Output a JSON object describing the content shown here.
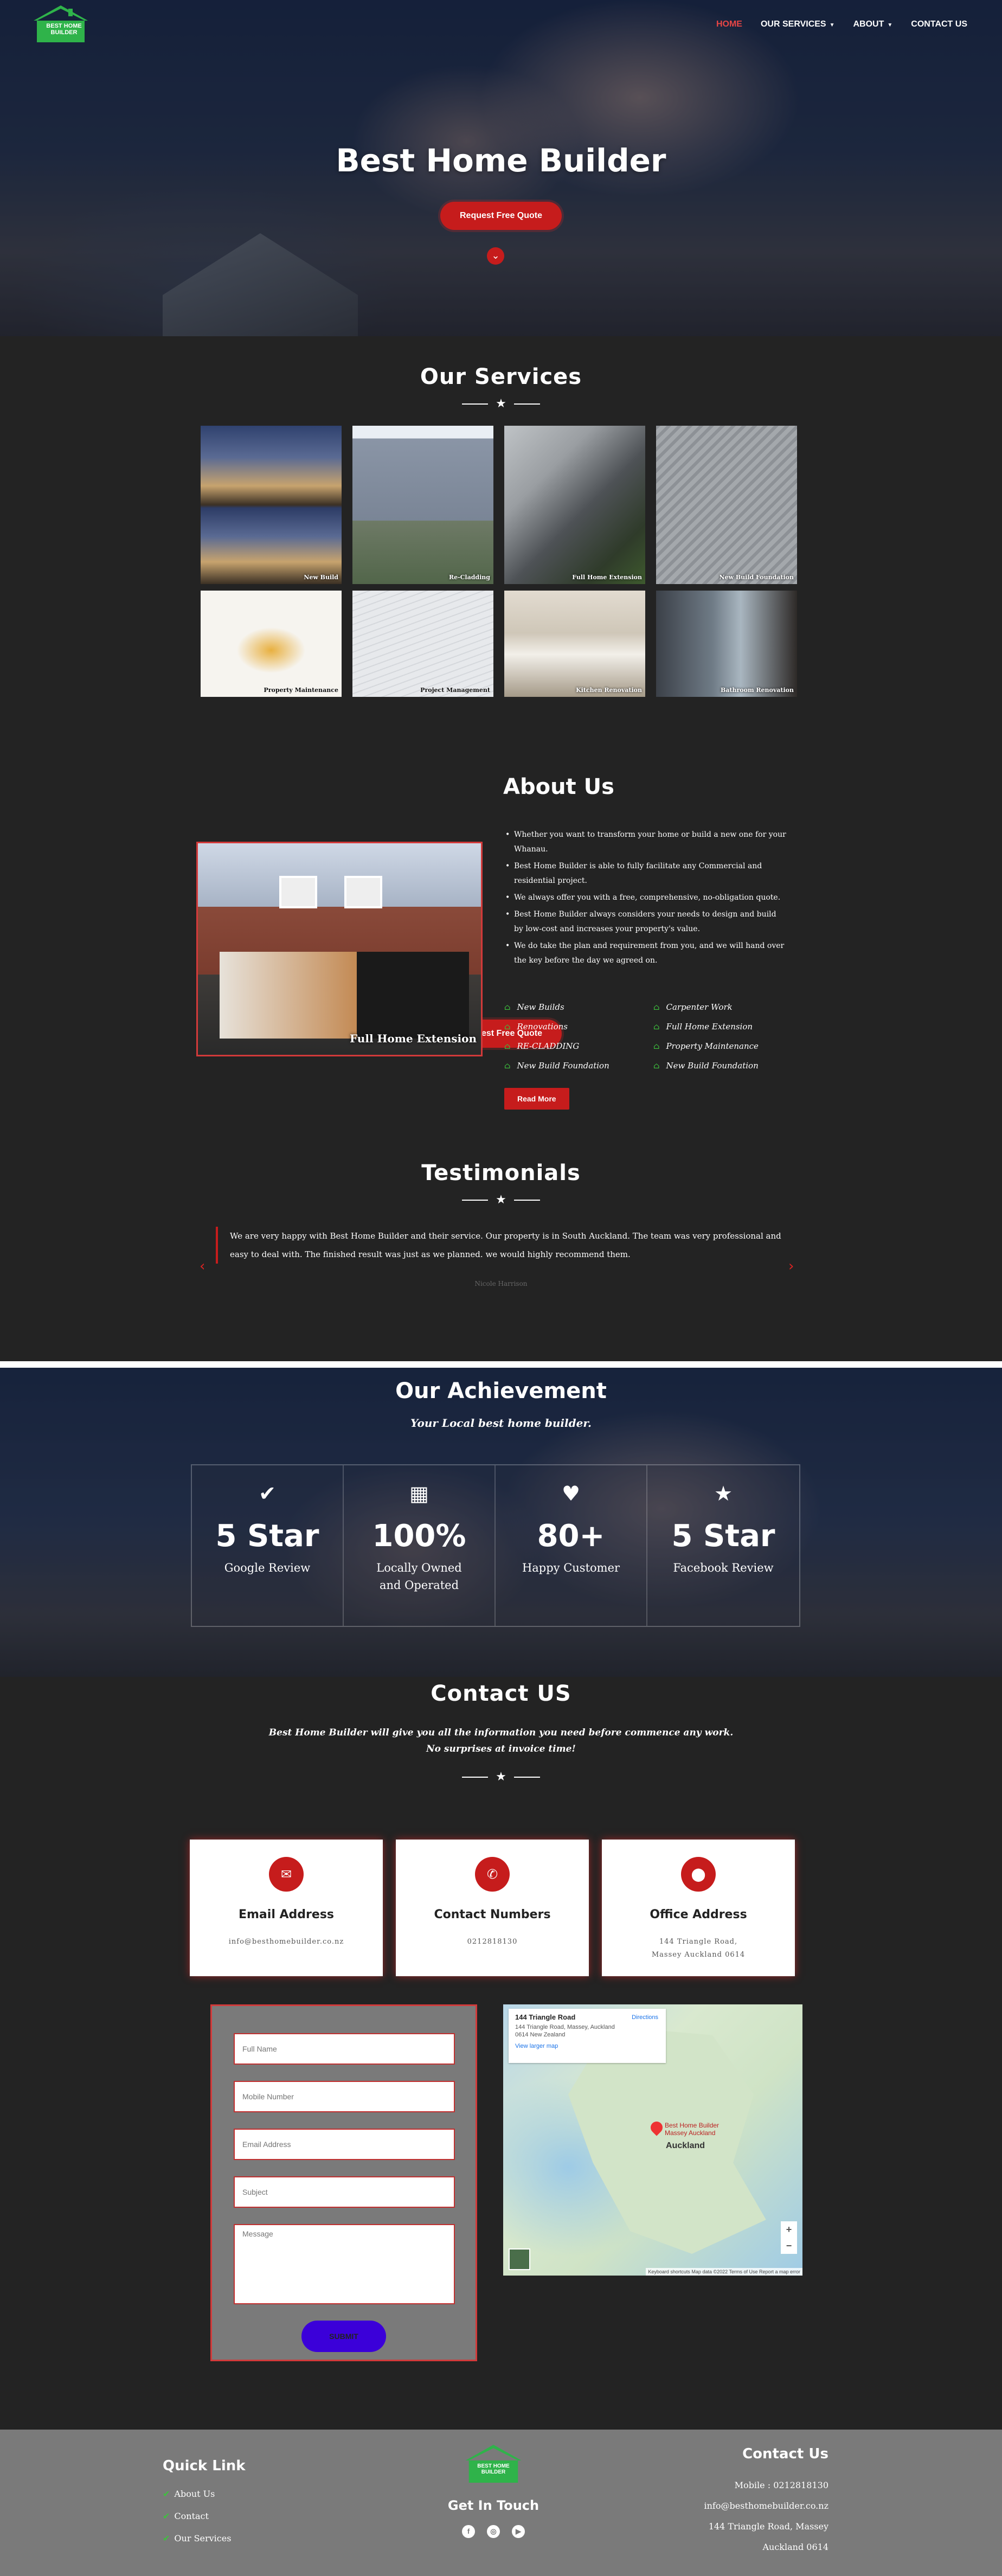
{
  "nav": {
    "logo_text": "BEST HOME BUILDER",
    "items": [
      {
        "label": "HOME",
        "active": true
      },
      {
        "label": "OUR SERVICES",
        "dropdown": true
      },
      {
        "label": "ABOUT",
        "dropdown": true
      },
      {
        "label": "CONTACT US"
      }
    ]
  },
  "hero": {
    "title": "Best Home Builder",
    "cta": "Request Free Quote",
    "scroll_icon": "chevron-down-circle-icon"
  },
  "services": {
    "title": "Our Services",
    "items": [
      {
        "caption": "New Build"
      },
      {
        "caption": "Re-Cladding"
      },
      {
        "caption": "Full Home Extension"
      },
      {
        "caption": "New Build Foundation"
      },
      {
        "caption": "Property Maintenance"
      },
      {
        "caption": "Project Management"
      },
      {
        "caption": "Kitchen Renovation"
      },
      {
        "caption": "Bathroom Renovation"
      }
    ],
    "cta": "Request Free Quote"
  },
  "about": {
    "title": "About Us",
    "image_caption": "Full Home Extension",
    "bullets": [
      "Whether you want to transform your home or build a new one for your Whanau.",
      "Best Home Builder is able to fully facilitate any Commercial and residential project.",
      "We always offer you with a free, comprehensive, no-obligation quote.",
      "Best Home Builder always considers your needs to design and build by low-cost and increases your property's value.",
      "We do take the plan and requirement from you, and we will hand over the key before the day we agreed on."
    ],
    "checks": [
      "New Builds",
      "Carpenter Work",
      "Renovations",
      "Full Home Extension",
      "RE-CLADDING",
      "Property Maintenance",
      "New Build Foundation",
      "New Build Foundation"
    ],
    "cta": "Read More"
  },
  "testimonials": {
    "title": "Testimonials",
    "quote": "We are very happy with Best Home Builder and their service. Our property is in South Auckland. The team was very professional and easy to deal with. The finished result was just as we planned. we would highly recommend them.",
    "author": "Nicole Harrison"
  },
  "achievement": {
    "title": "Our Achievement",
    "subtitle": "Your Local best home builder.",
    "cards": [
      {
        "icon": "check-circle-icon",
        "value": "5 Star",
        "label": "Google Review"
      },
      {
        "icon": "building-icon",
        "value": "100%",
        "label": "Locally Owned and Operated"
      },
      {
        "icon": "heart-icon",
        "value": "80+",
        "label": "Happy Customer"
      },
      {
        "icon": "star-icon",
        "value": "5 Star",
        "label": "Facebook Review"
      }
    ]
  },
  "contact": {
    "title": "Contact US",
    "sub_line1": "Best Home Builder will give you all the information you need before commence any work.",
    "sub_line2": "No surprises at invoice time!",
    "cards": [
      {
        "icon": "email-icon",
        "heading": "Email Address",
        "value": "info@besthomebuilder.co.nz"
      },
      {
        "icon": "phone-icon",
        "heading": "Contact Numbers",
        "value": "0212818130"
      },
      {
        "icon": "location-pin-icon",
        "heading": "Office Address",
        "value": "144 Triangle Road, Massey Auckland 0614"
      }
    ],
    "form": {
      "name_placeholder": "Full Name",
      "mobile_placeholder": "Mobile Number",
      "email_placeholder": "Email Address",
      "subject_placeholder": "Subject",
      "message_placeholder": "Message",
      "submit": "SUBMIT"
    },
    "map": {
      "place": "144 Triangle Road",
      "address": "144 Triangle Road, Massey, Auckland 0614 New Zealand",
      "directions": "Directions",
      "larger_map": "View larger map",
      "pin_label": "Best Home Builder Massey Auckland",
      "city": "Auckland",
      "attribution": "Keyboard shortcuts   Map data ©2022   Terms of Use   Report a map error"
    }
  },
  "footer": {
    "quick_title": "Quick Link",
    "quick_links": [
      "About Us",
      "Contact",
      "Our Services"
    ],
    "logo_text": "BEST HOME BUILDER",
    "get_in_touch": "Get In Touch",
    "social": [
      "facebook-icon",
      "instagram-icon",
      "youtube-icon"
    ],
    "contact_title": "Contact Us",
    "mobile": "Mobile : 0212818130",
    "email": "info@besthomebuilder.co.nz",
    "address1": "144 Triangle Road, Massey",
    "address2": "Auckland 0614"
  },
  "colors": {
    "accent": "#c61c1c",
    "background": "#232323",
    "check": "#3ec13e",
    "footer": "#7a7a7a",
    "submit": "#3b00d9"
  }
}
